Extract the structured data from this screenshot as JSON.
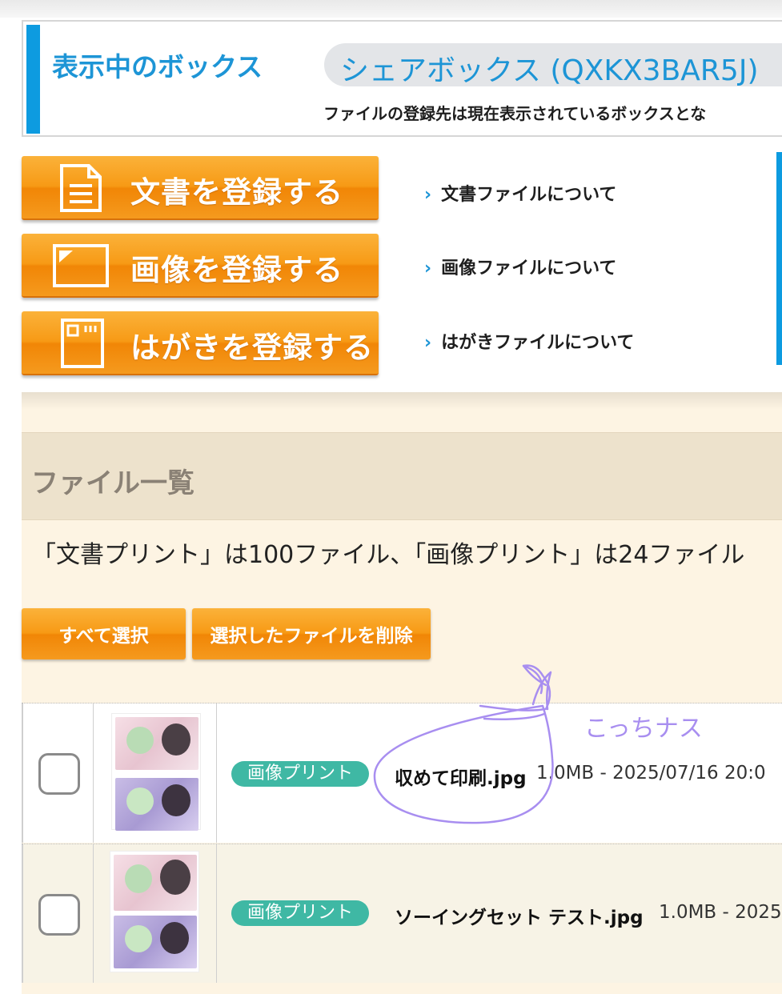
{
  "box": {
    "title": "表示中のボックス",
    "current_box": "シェアボックス (QXKX3BAR5J)",
    "note": "ファイルの登録先は現在表示されているボックスとな"
  },
  "register": [
    {
      "label": "文書を登録する",
      "icon": "document-icon",
      "info": "文書ファイルについて"
    },
    {
      "label": "画像を登録する",
      "icon": "image-icon",
      "info": "画像ファイルについて"
    },
    {
      "label": "はがきを登録する",
      "icon": "postcard-icon",
      "info": "はがきファイルについて"
    }
  ],
  "file_list": {
    "title": "ファイル一覧",
    "limit_text": "「文書プリント」は100ファイル、「画像プリント」は24ファイル",
    "select_all_label": "すべて選択",
    "delete_label": "選択したファイルを削除",
    "files": [
      {
        "type": "画像プリント",
        "name": "収めて印刷.jpg",
        "meta": "1.0MB - 2025/07/16 20:0"
      },
      {
        "type": "画像プリント",
        "name": "ソーイングセット テスト.jpg",
        "meta": "1.0MB - 2025"
      }
    ]
  },
  "annotation": {
    "handwritten_text": "こっちナス",
    "color": "#a88ef0"
  },
  "colors": {
    "accent_blue": "#0d9be0",
    "button_orange": "#f79a15",
    "badge_teal": "#3fb8a4",
    "beige_bg": "#fdf4e3"
  }
}
